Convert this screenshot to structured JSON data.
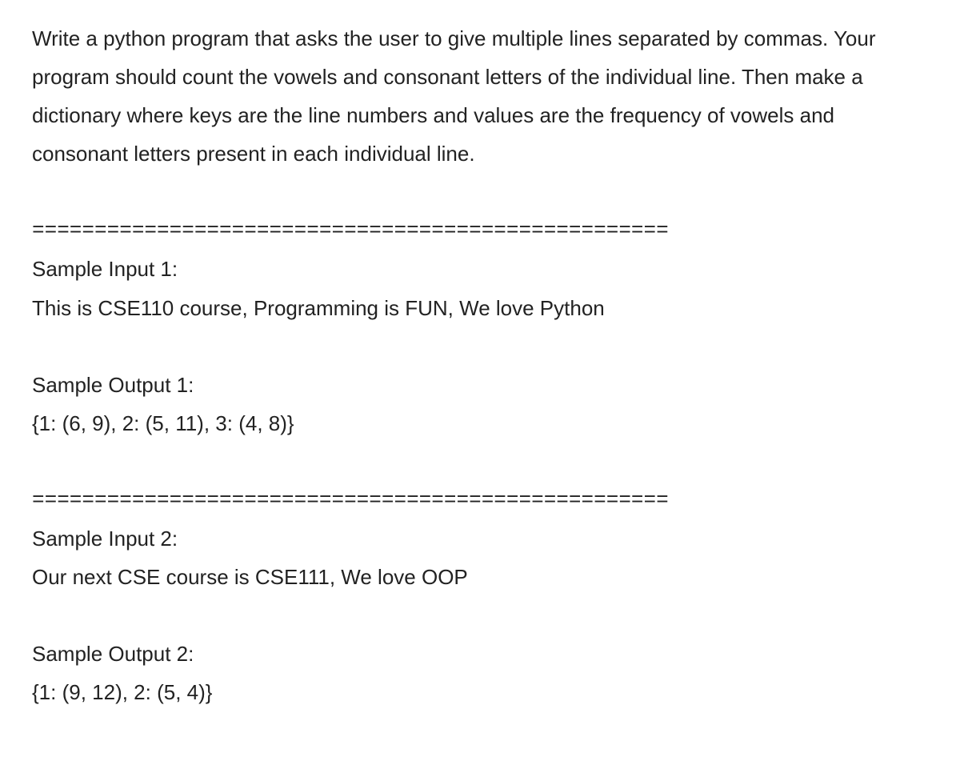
{
  "problem_statement": "Write a python program that asks the user to give multiple lines separated by commas. Your program should count the vowels and consonant letters of the individual line. Then make a dictionary where keys are the line numbers and values are the frequency of vowels and consonant letters present in each individual line.",
  "divider": "===================================================",
  "sample1": {
    "input_label": "Sample Input 1:",
    "input_text": "This is CSE110 course, Programming is FUN, We love Python",
    "output_label": "Sample Output 1:",
    "output_text": "{1: (6, 9), 2: (5, 11), 3: (4, 8)}"
  },
  "sample2": {
    "input_label": "Sample Input 2:",
    "input_text": "Our next CSE course is CSE111, We love OOP",
    "output_label": "Sample Output 2:",
    "output_text": "{1: (9, 12), 2: (5, 4)}"
  }
}
